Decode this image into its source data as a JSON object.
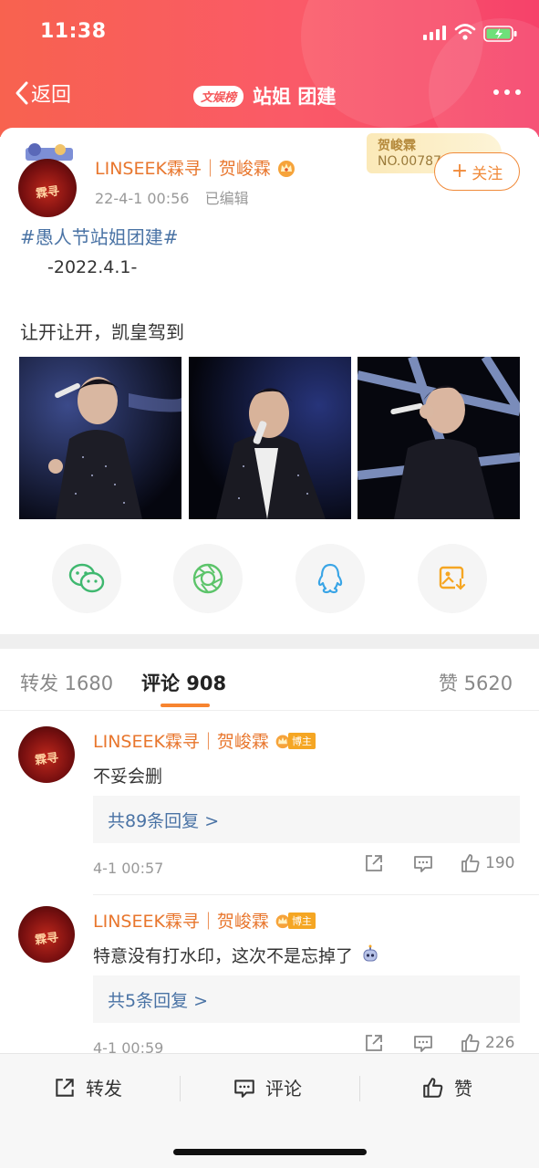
{
  "status": {
    "time": "11:38"
  },
  "nav": {
    "back_label": "返回",
    "rank_badge": "文娱榜",
    "title": "站姐 团建"
  },
  "post": {
    "author": "LINSEEK霖寻｜贺峻霖",
    "timestamp": "22-4-1 00:56",
    "edited": "已编辑",
    "avatar_text": "霖寻",
    "fan_card": {
      "name": "贺峻霖",
      "number": "NO.00787"
    },
    "follow_label": "关注",
    "topic": "#愚人节站姐团建#",
    "date_line": "-2022.4.1-",
    "text": "让开让开，凯皇驾到"
  },
  "share_icons": [
    "wechat-icon",
    "moments-icon",
    "qq-icon",
    "save-image-icon"
  ],
  "tabs": [
    {
      "label": "转发 1680"
    },
    {
      "label": "评论 908"
    },
    {
      "label": "赞 5620"
    }
  ],
  "comments": [
    {
      "author": "LINSEEK霖寻｜贺峻霖",
      "badge": "博主",
      "avatar_text": "霖寻",
      "text": "不妥会删",
      "reply_link": "共89条回复 >",
      "time": "4-1 00:57",
      "likes": "190"
    },
    {
      "author": "LINSEEK霖寻｜贺峻霖",
      "badge": "博主",
      "avatar_text": "霖寻",
      "text": "特意没有打水印，这次不是忘掉了",
      "reply_link": "共5条回复 >",
      "time": "4-1 00:59",
      "likes": "226"
    }
  ],
  "bottom": {
    "repost": "转发",
    "comment": "评论",
    "like": "赞"
  },
  "colors": {
    "header_start": "#f8624f",
    "header_end": "#f6426a",
    "accent_orange": "#f08a3a",
    "link_blue": "#4a73a5"
  }
}
